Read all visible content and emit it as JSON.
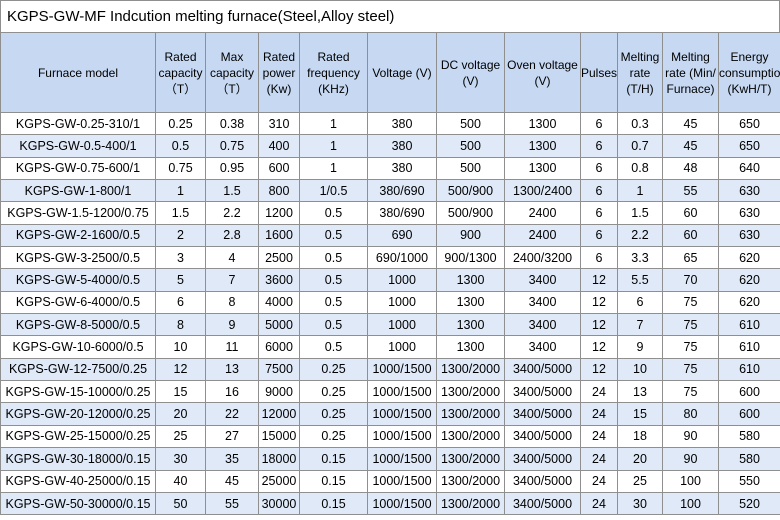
{
  "title": "KGPS-GW-MF Indcution melting furnace(Steel,Alloy steel)",
  "headers": [
    "Furnace model",
    "Rated capacity （T）",
    "Max capacity （T）",
    "Rated power (Kw)",
    "Rated frequency (KHz)",
    "Voltage (V)",
    "DC voltage (V)",
    "Oven voltage (V)",
    "Pulses",
    "Melting rate (T/H)",
    "Melting rate (Min/ Furnace)",
    "Energy consumption (KwH/T)"
  ],
  "rows": [
    [
      "KGPS-GW-0.25-310/1",
      "0.25",
      "0.38",
      "310",
      "1",
      "380",
      "500",
      "1300",
      "6",
      "0.3",
      "45",
      "650"
    ],
    [
      "KGPS-GW-0.5-400/1",
      "0.5",
      "0.75",
      "400",
      "1",
      "380",
      "500",
      "1300",
      "6",
      "0.7",
      "45",
      "650"
    ],
    [
      "KGPS-GW-0.75-600/1",
      "0.75",
      "0.95",
      "600",
      "1",
      "380",
      "500",
      "1300",
      "6",
      "0.8",
      "48",
      "640"
    ],
    [
      "KGPS-GW-1-800/1",
      "1",
      "1.5",
      "800",
      "1/0.5",
      "380/690",
      "500/900",
      "1300/2400",
      "6",
      "1",
      "55",
      "630"
    ],
    [
      "KGPS-GW-1.5-1200/0.75",
      "1.5",
      "2.2",
      "1200",
      "0.5",
      "380/690",
      "500/900",
      "2400",
      "6",
      "1.5",
      "60",
      "630"
    ],
    [
      "KGPS-GW-2-1600/0.5",
      "2",
      "2.8",
      "1600",
      "0.5",
      "690",
      "900",
      "2400",
      "6",
      "2.2",
      "60",
      "630"
    ],
    [
      "KGPS-GW-3-2500/0.5",
      "3",
      "4",
      "2500",
      "0.5",
      "690/1000",
      "900/1300",
      "2400/3200",
      "6",
      "3.3",
      "65",
      "620"
    ],
    [
      "KGPS-GW-5-4000/0.5",
      "5",
      "7",
      "3600",
      "0.5",
      "1000",
      "1300",
      "3400",
      "12",
      "5.5",
      "70",
      "620"
    ],
    [
      "KGPS-GW-6-4000/0.5",
      "6",
      "8",
      "4000",
      "0.5",
      "1000",
      "1300",
      "3400",
      "12",
      "6",
      "75",
      "620"
    ],
    [
      "KGPS-GW-8-5000/0.5",
      "8",
      "9",
      "5000",
      "0.5",
      "1000",
      "1300",
      "3400",
      "12",
      "7",
      "75",
      "610"
    ],
    [
      "KGPS-GW-10-6000/0.5",
      "10",
      "11",
      "6000",
      "0.5",
      "1000",
      "1300",
      "3400",
      "12",
      "9",
      "75",
      "610"
    ],
    [
      "KGPS-GW-12-7500/0.25",
      "12",
      "13",
      "7500",
      "0.25",
      "1000/1500",
      "1300/2000",
      "3400/5000",
      "12",
      "10",
      "75",
      "610"
    ],
    [
      "KGPS-GW-15-10000/0.25",
      "15",
      "16",
      "9000",
      "0.25",
      "1000/1500",
      "1300/2000",
      "3400/5000",
      "24",
      "13",
      "75",
      "600"
    ],
    [
      "KGPS-GW-20-12000/0.25",
      "20",
      "22",
      "12000",
      "0.25",
      "1000/1500",
      "1300/2000",
      "3400/5000",
      "24",
      "15",
      "80",
      "600"
    ],
    [
      "KGPS-GW-25-15000/0.25",
      "25",
      "27",
      "15000",
      "0.25",
      "1000/1500",
      "1300/2000",
      "3400/5000",
      "24",
      "18",
      "90",
      "580"
    ],
    [
      "KGPS-GW-30-18000/0.15",
      "30",
      "35",
      "18000",
      "0.15",
      "1000/1500",
      "1300/2000",
      "3400/5000",
      "24",
      "20",
      "90",
      "580"
    ],
    [
      "KGPS-GW-40-25000/0.15",
      "40",
      "45",
      "25000",
      "0.15",
      "1000/1500",
      "1300/2000",
      "3400/5000",
      "24",
      "25",
      "100",
      "550"
    ],
    [
      "KGPS-GW-50-30000/0.15",
      "50",
      "55",
      "30000",
      "0.15",
      "1000/1500",
      "1300/2000",
      "3400/5000",
      "24",
      "30",
      "100",
      "520"
    ]
  ]
}
